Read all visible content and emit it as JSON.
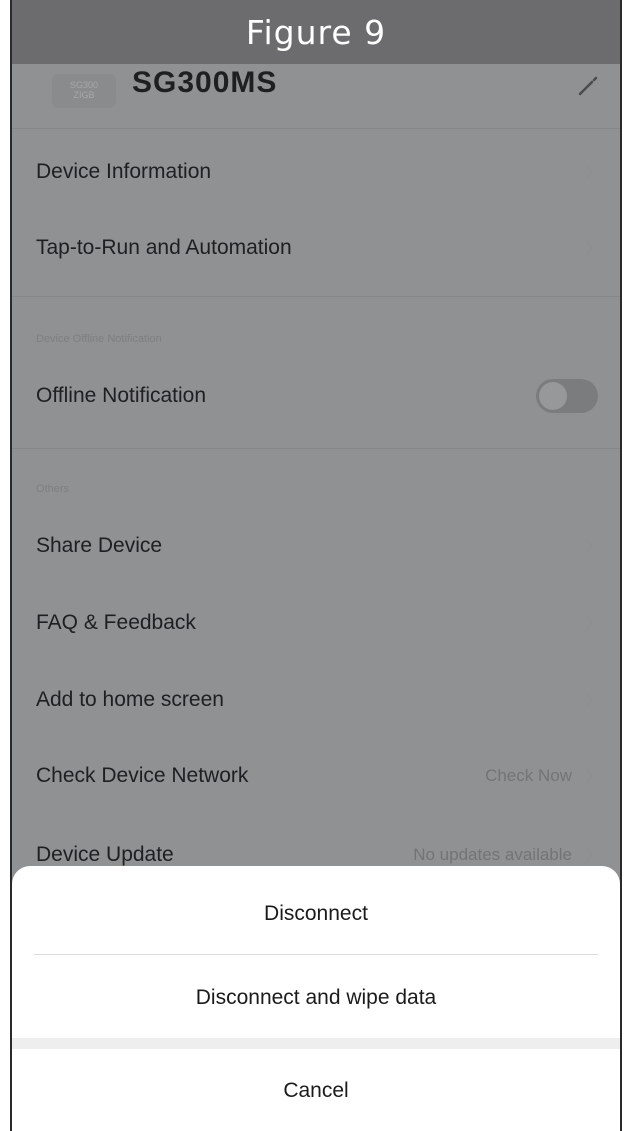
{
  "figure_caption": "Figure 9",
  "device": {
    "name": "SG300MS",
    "thumb_text_1": "SG300",
    "thumb_text_2": "ZIGB"
  },
  "settings": {
    "device_information": "Device Information",
    "tap_to_run": "Tap-to-Run and Automation",
    "offline_section": "Device Offline Notification",
    "offline_notification": "Offline Notification",
    "offline_notification_enabled": false,
    "others_section": "Others",
    "share_device": "Share Device",
    "faq_feedback": "FAQ & Feedback",
    "add_home_screen": "Add to home screen",
    "check_network": "Check Device Network",
    "check_network_value": "Check Now",
    "device_update": "Device Update",
    "device_update_value": "No updates available"
  },
  "sheet": {
    "disconnect": "Disconnect",
    "disconnect_wipe": "Disconnect and wipe data",
    "cancel": "Cancel"
  }
}
